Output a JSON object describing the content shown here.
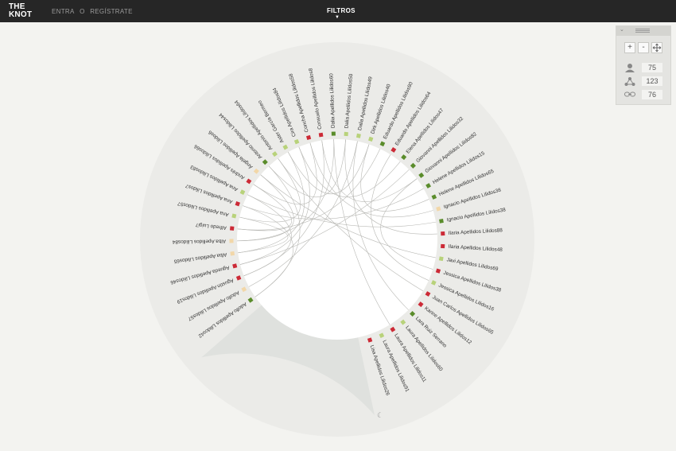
{
  "header": {
    "logo_line1": "THE",
    "logo_line2": "KNOT",
    "login": "ENTRA",
    "or": "O",
    "register": "REGÍSTRATE",
    "filters": "FILTROS"
  },
  "panel": {
    "zoom_in": "+",
    "zoom_out": "-",
    "people_count": "75",
    "links_count": "123",
    "connections_count": "76"
  },
  "colors": {
    "red": "#cc2a36",
    "green": "#5a8c2b",
    "lightgreen": "#b8d27a",
    "peach": "#f2d7a8"
  },
  "guests": [
    {
      "name": "Adolfo Apellidos Lilidos42",
      "color": "green"
    },
    {
      "name": "Adolfo Apellidos Lilidos57",
      "color": "peach"
    },
    {
      "name": "Agustín Apellidos Lilidos19",
      "color": "red"
    },
    {
      "name": "Agueda Apellidos Lilidos46",
      "color": "red"
    },
    {
      "name": "Alba Apellidos Lilidos65",
      "color": "peach"
    },
    {
      "name": "Alba Apellidos Lilidos84",
      "color": "peach"
    },
    {
      "name": "Alfredo Luigi7",
      "color": "red"
    },
    {
      "name": "Ana Apellidos Lilidos57",
      "color": "lightgreen"
    },
    {
      "name": "Ana Apellidos Lilidos7",
      "color": "red"
    },
    {
      "name": "Ana Apellidos Lilidos83",
      "color": "lightgreen"
    },
    {
      "name": "Andrés Apellidos Lilidos66",
      "color": "red"
    },
    {
      "name": "Ángela Apellidos Lilidos6",
      "color": "peach"
    },
    {
      "name": "Antonio Apellidos Lilidos44",
      "color": "green"
    },
    {
      "name": "Antonio Apellidos Lilidos64",
      "color": "lightgreen"
    },
    {
      "name": "Aster García Bermeo",
      "color": "lightgreen"
    },
    {
      "name": "Cira Apellidos Lilidos84",
      "color": "lightgreen"
    },
    {
      "name": "Concha Apellidos Lilidos58",
      "color": "red"
    },
    {
      "name": "Consuelo Apellidos Lilidos8",
      "color": "red"
    },
    {
      "name": "Dalia Apellidos Lilidos60",
      "color": "green"
    },
    {
      "name": "Dalia Apellidos Lilidos50",
      "color": "lightgreen"
    },
    {
      "name": "Dalia Apellidos Lilidos49",
      "color": "lightgreen"
    },
    {
      "name": "Dirk Apellidos Lilidos40",
      "color": "lightgreen"
    },
    {
      "name": "Eduardo Apellidos Lilidos90",
      "color": "green"
    },
    {
      "name": "Eduardo Apellidos Lilidos64",
      "color": "red"
    },
    {
      "name": "Elena Apellidos Lilidos47",
      "color": "green"
    },
    {
      "name": "Giovanni Apellidos Lilidos32",
      "color": "green"
    },
    {
      "name": "Giovanni Apellidos Lilidos82",
      "color": "green"
    },
    {
      "name": "Helene Apellidos Lilidos15",
      "color": "green"
    },
    {
      "name": "Helene Apellidos Lilidos65",
      "color": "green"
    },
    {
      "name": "Ignacio Apellidos Lilidos38",
      "color": "peach"
    },
    {
      "name": "Ignacio Apellidos Lilidos38",
      "color": "green"
    },
    {
      "name": "Ilaria Apellidos Lilidos88",
      "color": "red"
    },
    {
      "name": "Ilaria Apellidos Lilidos48",
      "color": "red"
    },
    {
      "name": "Javi Apellidos Lilidos69",
      "color": "lightgreen"
    },
    {
      "name": "Jessica Apellidos Lilidos38",
      "color": "red"
    },
    {
      "name": "Jessica Apellidos Lilidos16",
      "color": "lightgreen"
    },
    {
      "name": "Juan Carlos Apellidos Lilidos65",
      "color": "red"
    },
    {
      "name": "Karine Apellidos Lilidos12",
      "color": "red"
    },
    {
      "name": "Lara Ruiz Serrano",
      "color": "green"
    },
    {
      "name": "Laura Apellidos Lilidos60",
      "color": "lightgreen"
    },
    {
      "name": "Laura Apellidos Lilidos11",
      "color": "red"
    },
    {
      "name": "Laura Apellidos Lilidos91",
      "color": "lightgreen"
    },
    {
      "name": "Lisa Apellidos Lilidos26",
      "color": "red"
    }
  ]
}
